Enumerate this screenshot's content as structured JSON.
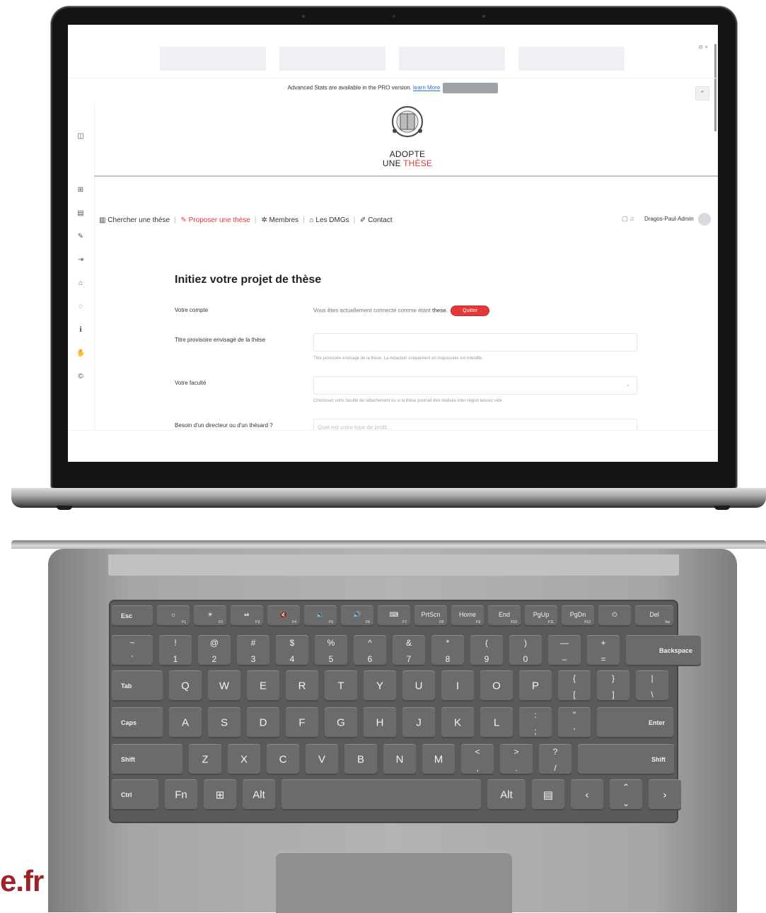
{
  "screen": {
    "stats_text": "Advanced Stats are available in the PRO version.",
    "stats_link": "learn More",
    "top_icons": "⊘ ×",
    "collapse_icon": "⌃",
    "logo": {
      "line1": "ADOPTE",
      "line2a": "UNE ",
      "line2b": "THÈSE"
    },
    "nav": [
      {
        "icon": "▥",
        "label": "Chercher une thèse"
      },
      {
        "icon": "✎",
        "label": "Proposer une thèse"
      },
      {
        "icon": "✲",
        "label": "Membres"
      },
      {
        "icon": "⌂",
        "label": "Les DMGs"
      },
      {
        "icon": "✐",
        "label": "Contact"
      }
    ],
    "user": {
      "name": "Dragos-Paul-Admin",
      "icons": "▢ ♫"
    },
    "form": {
      "title": "Initiez votre projet de thèse",
      "account_label": "Votre compte",
      "account_value": "Vous êtes actuellement connecté comme étant",
      "account_user": "these",
      "quit_label": "Quitter",
      "thesis_label": "Titre provisoire envisagé de la thèse",
      "thesis_hint": "Titre provisoire envisagé de la thèse. La rédaction uniquement en majuscules est interdite.",
      "faculty_label": "Votre faculté",
      "faculty_hint": "Choisissez votre faculté de rattachement ou si la thèse pourrait être réalisée inter-région laissez vide",
      "director_label": "Besoin d'un directeur ou d'un thésard ?",
      "director_placeholder": "Quel est votre type de profil..."
    }
  },
  "keyboard": {
    "row1": [
      {
        "c": "Esc"
      },
      {
        "c": "☼",
        "f": "F1"
      },
      {
        "c": "☀",
        "f": "F2"
      },
      {
        "c": "⏯",
        "f": "F3"
      },
      {
        "c": "🔇",
        "f": "F4"
      },
      {
        "c": "🔉",
        "f": "F5"
      },
      {
        "c": "🔊",
        "f": "F6"
      },
      {
        "c": "⌨",
        "f": "F7"
      },
      {
        "c": "PrtScn",
        "f": "F8"
      },
      {
        "c": "Home",
        "f": "F9"
      },
      {
        "c": "End",
        "f": "F10"
      },
      {
        "c": "PgUp",
        "f": "F11"
      },
      {
        "c": "PgDn",
        "f": "F12"
      },
      {
        "c": "⏻"
      },
      {
        "c": "Del",
        "f": "Ins"
      }
    ],
    "row2": [
      {
        "t": "~",
        "b": "`"
      },
      {
        "t": "!",
        "b": "1"
      },
      {
        "t": "@",
        "b": "2"
      },
      {
        "t": "#",
        "b": "3"
      },
      {
        "t": "$",
        "b": "4"
      },
      {
        "t": "%",
        "b": "5"
      },
      {
        "t": "^",
        "b": "6"
      },
      {
        "t": "&",
        "b": "7"
      },
      {
        "t": "*",
        "b": "8"
      },
      {
        "t": "(",
        "b": "9"
      },
      {
        "t": ")",
        "b": "0"
      },
      {
        "t": "—",
        "b": "–"
      },
      {
        "t": "+",
        "b": "="
      },
      {
        "r": "Backspace"
      }
    ],
    "row3": [
      {
        "l": "Tab"
      },
      {
        "c": "Q"
      },
      {
        "c": "W"
      },
      {
        "c": "E"
      },
      {
        "c": "R"
      },
      {
        "c": "T"
      },
      {
        "c": "Y"
      },
      {
        "c": "U"
      },
      {
        "c": "I"
      },
      {
        "c": "O"
      },
      {
        "c": "P"
      },
      {
        "t": "{",
        "b": "["
      },
      {
        "t": "}",
        "b": "]"
      },
      {
        "t": "|",
        "b": "\\"
      }
    ],
    "row4": [
      {
        "l": "Caps"
      },
      {
        "c": "A"
      },
      {
        "c": "S"
      },
      {
        "c": "D"
      },
      {
        "c": "F"
      },
      {
        "c": "G"
      },
      {
        "c": "H"
      },
      {
        "c": "J"
      },
      {
        "c": "K"
      },
      {
        "c": "L"
      },
      {
        "t": ":",
        "b": ";"
      },
      {
        "t": "\"",
        "b": "'"
      },
      {
        "r": "Enter"
      }
    ],
    "row5": [
      {
        "l": "Shift"
      },
      {
        "c": "Z"
      },
      {
        "c": "X"
      },
      {
        "c": "C"
      },
      {
        "c": "V"
      },
      {
        "c": "B"
      },
      {
        "c": "N"
      },
      {
        "c": "M"
      },
      {
        "t": "<",
        "b": ","
      },
      {
        "t": ">",
        "b": "."
      },
      {
        "t": "?",
        "b": "/"
      },
      {
        "r": "Shift"
      }
    ],
    "row6": [
      {
        "l": "Ctrl"
      },
      {
        "c": "Fn"
      },
      {
        "c": "⊞"
      },
      {
        "c": "Alt"
      },
      {
        "c": ""
      },
      {
        "c": "Alt"
      },
      {
        "c": "▤"
      },
      {
        "c": "‹"
      },
      {
        "t": "⌃",
        "b": "⌄"
      },
      {
        "c": "›"
      }
    ]
  },
  "footer": {
    "domain_fragment": "e.fr"
  }
}
